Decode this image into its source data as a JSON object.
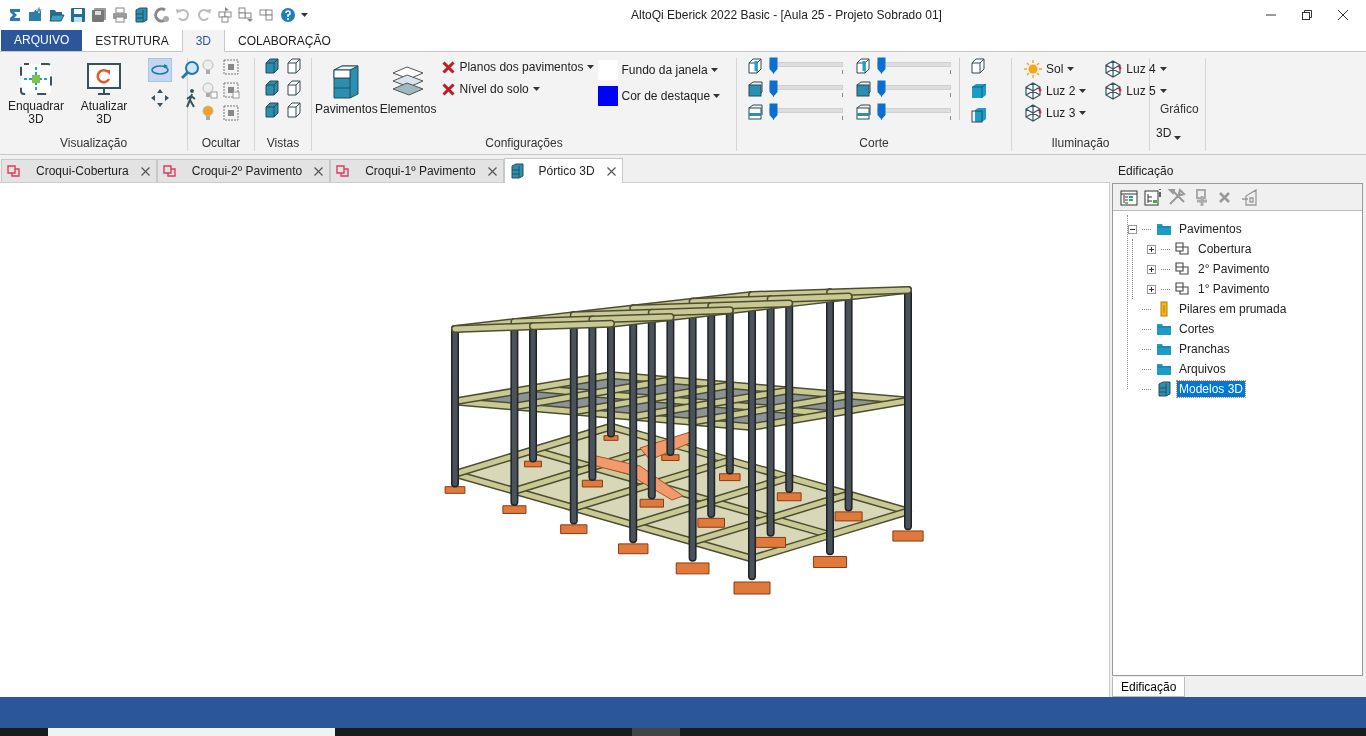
{
  "window": {
    "title": "AltoQi Eberick 2022 Basic - [Aula 25 - Projeto Sobrado 01]"
  },
  "ribbon_tabs": [
    {
      "label": "ARQUIVO",
      "kind": "file",
      "selected": false
    },
    {
      "label": "ESTRUTURA",
      "kind": "tab",
      "selected": false
    },
    {
      "label": "3D",
      "kind": "tab",
      "selected": true
    },
    {
      "label": "COLABORAÇÃO",
      "kind": "tab",
      "selected": false
    }
  ],
  "visualizacao": {
    "label": "Visualização",
    "buttons": [
      "Enquadrar 3D",
      "Atualizar 3D"
    ],
    "nav_tools": [
      {
        "kind": "orbit",
        "selected": true
      },
      {
        "kind": "zoom",
        "selected": false
      },
      {
        "kind": "pan",
        "selected": false
      },
      {
        "kind": "walk",
        "selected": false
      }
    ]
  },
  "ocultar": {
    "label": "Ocultar"
  },
  "vistas": {
    "label": "Vistas"
  },
  "configuracoes": {
    "label": "Configurações",
    "buttons": [
      "Pavimentos",
      "Elementos"
    ],
    "options": [
      "Planos dos pavimentos",
      "Nível do solo"
    ],
    "colors": [
      {
        "label": "Fundo da janela",
        "color": "#ffffff"
      },
      {
        "label": "Cor de destaque",
        "color": "#0000ff"
      }
    ]
  },
  "corte": {
    "label": "Corte",
    "sliders": [
      {
        "level": 0
      },
      {
        "level": 0
      },
      {
        "level": 0
      },
      {
        "level": 0
      },
      {
        "level": 0
      },
      {
        "level": 0
      }
    ]
  },
  "iluminacao": {
    "label": "Iluminação",
    "lights": [
      {
        "label": "Sol",
        "kind": "sun"
      },
      {
        "label": "Luz 2",
        "kind": "lamp"
      },
      {
        "label": "Luz 3",
        "kind": "lamp"
      },
      {
        "label": "Luz 4",
        "kind": "lamp"
      },
      {
        "label": "Luz 5",
        "kind": "lamp"
      }
    ]
  },
  "grafico": {
    "label": "Gráfico",
    "button": "3D"
  },
  "doc_tabs": [
    {
      "label": "Croqui-Cobertura",
      "kind": "sketch",
      "selected": false
    },
    {
      "label": "Croqui-2º Pavimento",
      "kind": "sketch",
      "selected": false
    },
    {
      "label": "Croqui-1º Pavimento",
      "kind": "sketch",
      "selected": false
    },
    {
      "label": "Pórtico 3D",
      "kind": "model",
      "selected": true
    }
  ],
  "panel": {
    "title": "Edificação",
    "tree": [
      {
        "label": "Pavimentos",
        "kind": "folder",
        "expanded": true,
        "selected": false,
        "children": [
          {
            "label": "Cobertura",
            "kind": "floor",
            "expanded": false,
            "selected": false
          },
          {
            "label": "2° Pavimento",
            "kind": "floor",
            "expanded": false,
            "selected": false
          },
          {
            "label": "1° Pavimento",
            "kind": "floor",
            "expanded": false,
            "selected": false
          }
        ]
      },
      {
        "label": "Pilares em prumada",
        "kind": "pillar",
        "selected": false
      },
      {
        "label": "Cortes",
        "kind": "folder",
        "selected": false
      },
      {
        "label": "Pranchas",
        "kind": "folder",
        "selected": false
      },
      {
        "label": "Arquivos",
        "kind": "folder",
        "selected": false
      },
      {
        "label": "Modelos 3D",
        "kind": "model",
        "selected": true
      }
    ],
    "bottom_tab": "Edificação"
  }
}
